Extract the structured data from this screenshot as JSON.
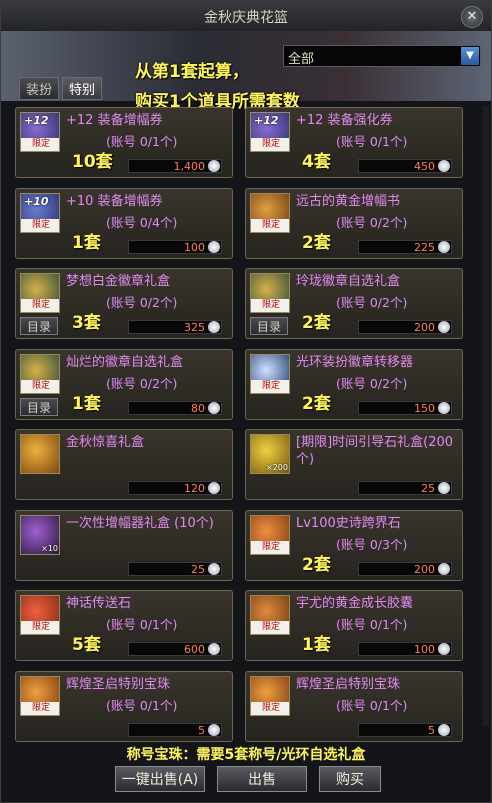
{
  "window": {
    "title": "金秋庆典花篮",
    "close_symbol": "✕"
  },
  "tabs": [
    {
      "label": "装扮"
    },
    {
      "label": "特别"
    }
  ],
  "filter": {
    "value": "全部",
    "arrow": "▼"
  },
  "note": {
    "line1": "从第1套起算，",
    "line2": "购买1个道具所需套数"
  },
  "catalog_label": "目录",
  "limited_label": "限定",
  "colors": {
    "name": "#e08af0",
    "sets": "#fff45c",
    "price": "#ff7a5a"
  },
  "items": [
    {
      "name": "+12 装备增幅券",
      "account": "(账号 0/1个)",
      "sets": "10套",
      "price": "1,400",
      "icon": "plus12-icon",
      "plus": "+12",
      "limited": true,
      "catalog": false
    },
    {
      "name": "+12 装备强化券",
      "account": "(账号 0/1个)",
      "sets": "4套",
      "price": "450",
      "icon": "plus12-icon",
      "plus": "+12",
      "limited": true,
      "catalog": false
    },
    {
      "name": "+10 装备增幅券",
      "account": "(账号 0/4个)",
      "sets": "1套",
      "price": "100",
      "icon": "plus10-icon",
      "plus": "+10",
      "limited": true,
      "catalog": false
    },
    {
      "name": "远古的黄金增幅书",
      "account": "(账号 0/2个)",
      "sets": "2套",
      "price": "225",
      "icon": "book-icon",
      "limited": true,
      "catalog": false
    },
    {
      "name": "梦想白金徽章礼盒",
      "account": "(账号 0/2个)",
      "sets": "3套",
      "price": "325",
      "icon": "emblem-box-icon",
      "limited": true,
      "catalog": true
    },
    {
      "name": "玲珑徽章自选礼盒",
      "account": "(账号 0/2个)",
      "sets": "2套",
      "price": "200",
      "icon": "emblem-box-icon",
      "limited": true,
      "catalog": true
    },
    {
      "name": "灿烂的徽章自选礼盒",
      "account": "(账号 0/2个)",
      "sets": "1套",
      "price": "80",
      "icon": "emblem-box-icon",
      "limited": true,
      "catalog": true
    },
    {
      "name": "光环装扮徽章转移器",
      "account": "(账号 0/2个)",
      "sets": "2套",
      "price": "150",
      "icon": "transfer-icon",
      "limited": true,
      "catalog": false
    },
    {
      "name": "金秋惊喜礼盒",
      "account": "",
      "sets": "",
      "price": "120",
      "icon": "gift-box-icon",
      "limited": false,
      "catalog": false
    },
    {
      "name": "[期限]时间引导石礼盒(200个)",
      "account": "",
      "sets": "",
      "price": "25",
      "icon": "stone-icon",
      "stack": "×200",
      "limited": false,
      "catalog": false
    },
    {
      "name": "一次性增幅器礼盒 (10个)",
      "account": "",
      "sets": "",
      "price": "25",
      "icon": "amplifier-icon",
      "stack": "×10",
      "limited": false,
      "catalog": false
    },
    {
      "name": "Lv100史诗跨界石",
      "account": "(账号 0/3个)",
      "sets": "2套",
      "price": "200",
      "icon": "epic-stone-icon",
      "limited": true,
      "catalog": false
    },
    {
      "name": "神话传送石",
      "account": "(账号 0/1个)",
      "sets": "5套",
      "price": "600",
      "icon": "myth-stone-icon",
      "limited": true,
      "catalog": false
    },
    {
      "name": "宇尤的黄金成长胶囊",
      "account": "(账号 0/1个)",
      "sets": "1套",
      "price": "100",
      "icon": "capsule-icon",
      "limited": true,
      "catalog": false
    },
    {
      "name": "辉煌圣启特别宝珠",
      "account": "(账号 0/1个)",
      "sets": "",
      "price": "5",
      "icon": "orb-icon",
      "limited": true,
      "catalog": false
    },
    {
      "name": "辉煌圣启特别宝珠",
      "account": "(账号 0/1个)",
      "sets": "",
      "price": "5",
      "icon": "orb-icon",
      "limited": true,
      "catalog": false
    }
  ],
  "footer": {
    "note": "称号宝珠：需要5套称号/光环自选礼盒",
    "sell_all_label": "一键出售(A)",
    "sell_label": "出售",
    "buy_label": "购买"
  }
}
